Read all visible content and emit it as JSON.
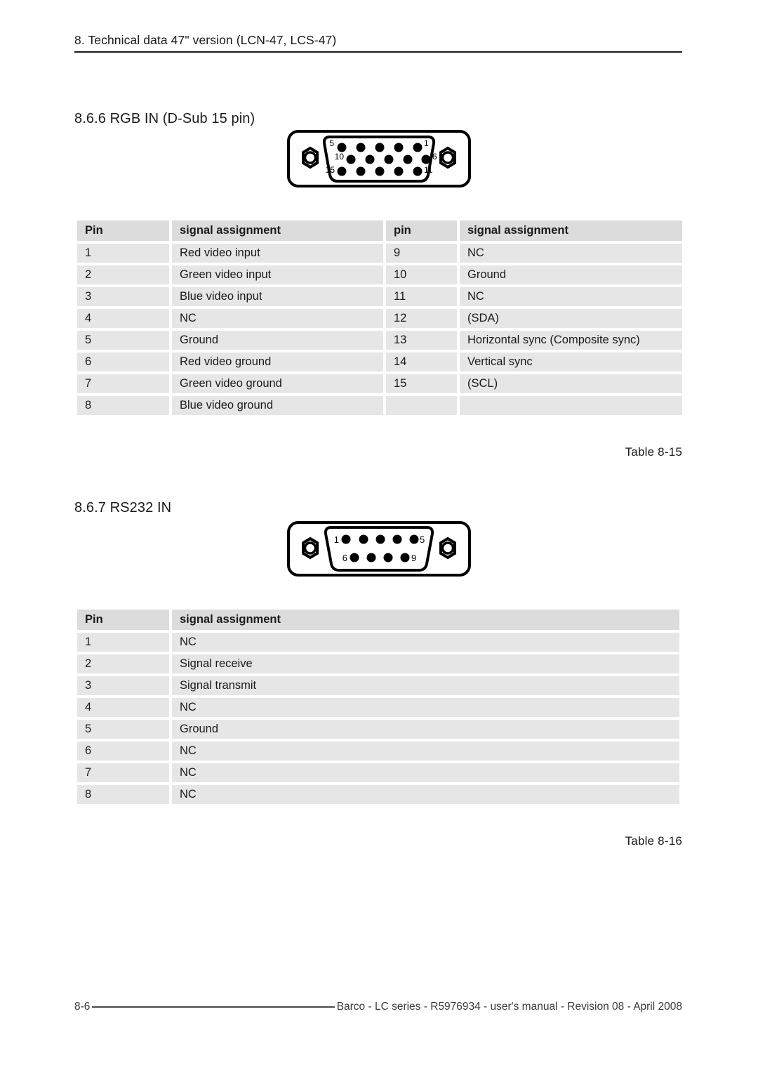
{
  "header": {
    "chapter_title": "8. Technical data 47\" version (LCN-47, LCS-47)"
  },
  "sections": {
    "rgb": {
      "heading": "8.6.6 RGB IN (D-Sub 15 pin)",
      "connector": {
        "type": "D-Sub 15 pin (DE-15 / HD-15)",
        "rows": [
          {
            "labels": [
              "5",
              "1"
            ],
            "pin_count": 5
          },
          {
            "labels": [
              "10",
              "6"
            ],
            "pin_count": 5
          },
          {
            "labels": [
              "15",
              "11"
            ],
            "pin_count": 5
          }
        ]
      },
      "table": {
        "headers": [
          "Pin",
          "signal assignment",
          "pin",
          "signal assignment"
        ],
        "rows": [
          [
            "1",
            "Red video input",
            "9",
            "NC"
          ],
          [
            "2",
            "Green video input",
            "10",
            "Ground"
          ],
          [
            "3",
            "Blue video input",
            "11",
            "NC"
          ],
          [
            "4",
            "NC",
            "12",
            "(SDA)"
          ],
          [
            "5",
            "Ground",
            "13",
            "Horizontal sync (Composite sync)"
          ],
          [
            "6",
            "Red video ground",
            "14",
            "Vertical sync"
          ],
          [
            "7",
            "Green video ground",
            "15",
            "(SCL)"
          ],
          [
            "8",
            "Blue video ground",
            "",
            ""
          ]
        ],
        "caption": "Table 8-15"
      }
    },
    "rs232": {
      "heading": "8.6.7 RS232 IN",
      "connector": {
        "type": "D-Sub 9 pin (DE-9)",
        "rows": [
          {
            "labels": [
              "1",
              "5"
            ],
            "pin_count": 5
          },
          {
            "labels": [
              "6",
              "9"
            ],
            "pin_count": 4
          }
        ]
      },
      "table": {
        "headers": [
          "Pin",
          "signal assignment"
        ],
        "rows": [
          [
            "1",
            "NC"
          ],
          [
            "2",
            "Signal receive"
          ],
          [
            "3",
            "Signal transmit"
          ],
          [
            "4",
            "NC"
          ],
          [
            "5",
            "Ground"
          ],
          [
            "6",
            "NC"
          ],
          [
            "7",
            "NC"
          ],
          [
            "8",
            "NC"
          ]
        ],
        "caption": "Table 8-16"
      }
    }
  },
  "footer": {
    "page_number": "8-6",
    "imprint": "Barco - LC series - R5976934 - user's manual - Revision 08 - April 2008"
  },
  "colors": {
    "cell_background": "#e6e6e6",
    "header_cell_background": "#dcdcdc",
    "text": "#1a1a1a",
    "rule": "#1a1a1a",
    "footer_text": "#3a3a3a"
  }
}
